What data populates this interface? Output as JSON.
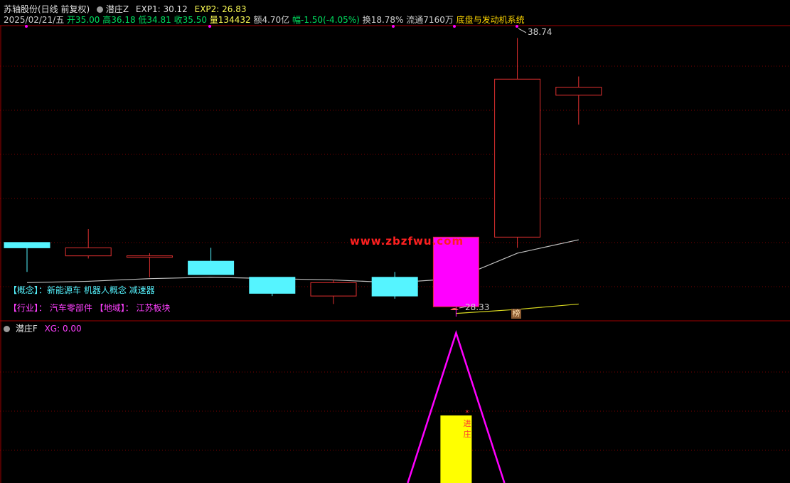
{
  "header": {
    "stock_title": "苏轴股份(日线 前复权)",
    "indicator_name": "潜庄Z",
    "exp1_label": "EXP1: 30.12",
    "exp2_label": "EXP2: 26.83",
    "date": "2025/02/21/五",
    "open": "开35.00",
    "high": "高36.18",
    "low": "低34.81",
    "close": "收35.50",
    "volume": "量134432",
    "amount": "额4.70亿",
    "change": "幅-1.50(-4.05%)",
    "turnover": "换18.78%",
    "float": "流通7160万",
    "sector": "底盘与发动机系统"
  },
  "main_chart": {
    "high_label": "38.74",
    "low_label": "28.33",
    "watermark": "www.zbzfwu.com",
    "badge": "榜",
    "concept_line": "【概念】：新能源车 机器人概念 减速器",
    "industry_prefix": "【行业】：",
    "industry_value": "汽车零部件",
    "region_prefix": "【地域】：",
    "region_value": "江苏板块"
  },
  "sub_chart": {
    "indicator_name": "潜庄F",
    "xg_label": "XG: 0.00",
    "vertical_text": "*进庄"
  },
  "colors": {
    "up": "#e03030",
    "down": "#55f4ff",
    "magenta": "#ff00ff",
    "yellow": "#ffff00",
    "ma_gray": "#c0c0c0",
    "grid": "#6a0000"
  },
  "chart_data": {
    "type": "candlestick",
    "candles": [
      {
        "open": 31.1,
        "high": 31.1,
        "low": 30.0,
        "close": 30.9,
        "color": "cyan"
      },
      {
        "open": 30.6,
        "high": 31.6,
        "low": 30.5,
        "close": 30.9,
        "color": "red"
      },
      {
        "open": 30.6,
        "high": 30.7,
        "low": 29.8,
        "close": 30.6,
        "color": "red"
      },
      {
        "open": 30.4,
        "high": 30.9,
        "low": 29.9,
        "close": 29.9,
        "color": "cyan"
      },
      {
        "open": 29.8,
        "high": 29.8,
        "low": 29.1,
        "close": 29.2,
        "color": "cyan"
      },
      {
        "open": 29.6,
        "high": 29.7,
        "low": 28.8,
        "close": 29.1,
        "color": "red"
      },
      {
        "open": 29.8,
        "high": 30.0,
        "low": 29.0,
        "close": 29.1,
        "color": "cyan"
      },
      {
        "open": 28.7,
        "high": 31.3,
        "low": 28.33,
        "close": 31.3,
        "color": "magenta"
      },
      {
        "open": 31.3,
        "high": 38.74,
        "low": 30.9,
        "close": 37.2,
        "color": "red"
      },
      {
        "open": 36.6,
        "high": 37.3,
        "low": 35.5,
        "close": 36.9,
        "color": "red"
      }
    ],
    "ma_white": [
      29.6,
      29.65,
      29.75,
      29.8,
      29.75,
      29.7,
      29.6,
      29.75,
      30.7,
      31.2
    ],
    "ma_yellow": [
      null,
      null,
      null,
      null,
      null,
      null,
      null,
      28.45,
      28.6,
      28.8
    ],
    "y_range": [
      28.2,
      39.2
    ],
    "sub_triangle": {
      "apex_index": 7,
      "peak": 1.0
    },
    "sub_bar": {
      "index": 7,
      "value": 0.45
    }
  }
}
